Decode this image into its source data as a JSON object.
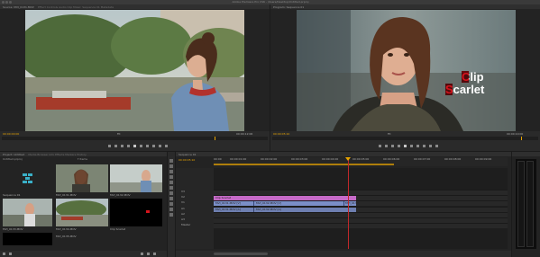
{
  "app": {
    "window_title": "Adobe Premiere Pro CS6 - /Users/Desktop/Untitled.prproj",
    "source_tab": "Source: MVI_0131.MOV",
    "source_tabs_extra": "Effect Controls    Audio Clip Mixer: Sequence 01    Metadata",
    "program_tab": "Program: Sequence 01"
  },
  "source_monitor": {
    "timecode_in": "00:00:00:00",
    "fit": "Fit",
    "timecode_dur": "00:00:12:06"
  },
  "program_monitor": {
    "title_line1": "Clip",
    "title_line2": "Scarlet",
    "timecode_in": "00:00:05:10",
    "fit": "Fit",
    "timecode_dur": "00:00:10:00"
  },
  "project": {
    "tab": "Project: Untitled",
    "tabs_extra": "Media Browser   Info   Effects   Markers   History",
    "path": "Untitled.prproj",
    "items_count": "7 Items",
    "thumbs": [
      {
        "label": "Sequence 01",
        "sub": "10:00"
      },
      {
        "label": "MVI_0131.MOV",
        "sub": "12:06"
      },
      {
        "label": "MVI_0132.MOV",
        "sub": "8:14"
      },
      {
        "label": "MVI_0133.MOV",
        "sub": "6:02"
      },
      {
        "label": "MVI_0134.MOV",
        "sub": "9:20"
      },
      {
        "label": "Clip Scarlet",
        "sub": "5:00"
      },
      {
        "label": "MVI_0135.MOV",
        "sub": "7:11"
      }
    ]
  },
  "timeline": {
    "tab": "Sequence 01",
    "timecode": "00:00:05:10",
    "ruler": [
      "00:00",
      "00:00:01:00",
      "00:00:02:00",
      "00:00:03:00",
      "00:00:04:00",
      "00:00:05:00",
      "00:00:06:00",
      "00:00:07:00",
      "00:00:08:00",
      "00:00:09:00"
    ],
    "tracks": [
      "V3",
      "V2",
      "V1",
      "A1",
      "A2",
      "A3",
      "Master"
    ],
    "clip_v2": "Clip Scarlet",
    "clip_v1_a": "MVI_0131.MOV [V]",
    "clip_v1_b": "MVI_0132.MOV [V]",
    "clip_v1_c": "MVI_0134",
    "clip_a1_a": "MVI_0131.MOV [A]",
    "clip_a1_b": "MVI_0132.MOV [A]"
  },
  "colors": {
    "accent": "#e8a400",
    "video_clip": "#c66ac8",
    "audio_clip": "#7b8fc8",
    "title_red": "#d6141c"
  }
}
